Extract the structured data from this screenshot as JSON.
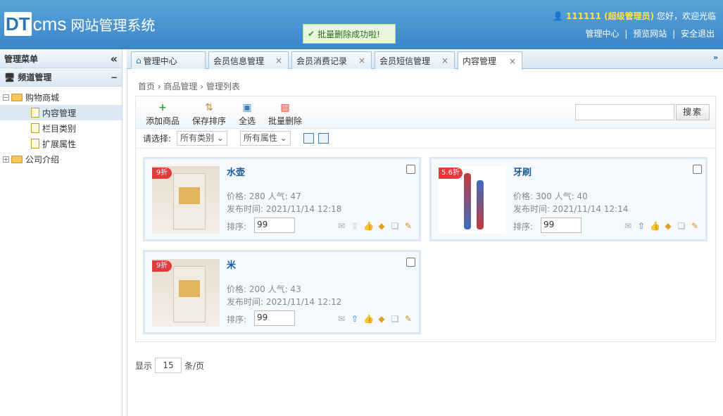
{
  "header": {
    "logo_dt": "DT",
    "logo_cms": "cms",
    "logo_sub": "网站管理系统",
    "toast": "批量删除成功啦!",
    "user_name": "111111 (超级管理员)",
    "greeting": "您好，欢迎光临",
    "links": [
      "管理中心",
      "预览网站",
      "安全退出"
    ],
    "sep": "|"
  },
  "sidebar": {
    "title": "管理菜单",
    "collapse": "«",
    "channel": "频道管理",
    "channel_toggle": "−",
    "tree": {
      "shop": "购物商城",
      "content": "内容管理",
      "category": "栏目类别",
      "ext": "扩展属性",
      "about": "公司介绍"
    }
  },
  "tabs": [
    {
      "label": "管理中心"
    },
    {
      "label": "会员信息管理"
    },
    {
      "label": "会员消费记录"
    },
    {
      "label": "会员短信管理"
    },
    {
      "label": "内容管理"
    }
  ],
  "tab_close": "×",
  "tabs_more": "»",
  "breadcrumb": "首页 › 商品管理 › 管理列表",
  "toolbar": {
    "add": "添加商品",
    "save_sort": "保存排序",
    "select_all": "全选",
    "batch_delete": "批量删除",
    "search_btn": "搜索",
    "search_placeholder": ""
  },
  "filter": {
    "label": "请选择:",
    "category": "所有类别 ⌄",
    "property": "所有属性 ⌄"
  },
  "products": [
    {
      "name": "水壶",
      "price": "价格: 280  人气: 47",
      "date": "发布时间: 2021/11/14 12:18",
      "sort_label": "排序:",
      "sort": "99",
      "tag": "9折"
    },
    {
      "name": "牙刷",
      "price": "价格: 300  人气: 40",
      "date": "发布时间: 2021/11/14 12:14",
      "sort_label": "排序:",
      "sort": "99",
      "tag": "5.6折"
    },
    {
      "name": "米",
      "price": "价格: 200  人气: 43",
      "date": "发布时间: 2021/11/14 12:12",
      "sort_label": "排序:",
      "sort": "99",
      "tag": "9折"
    }
  ],
  "pager": {
    "show": "显示",
    "size": "15",
    "unit": "条/页"
  },
  "colors": {
    "header": "#3a86c8",
    "title": "#1a5b9a",
    "accent": "#ffe04a"
  }
}
